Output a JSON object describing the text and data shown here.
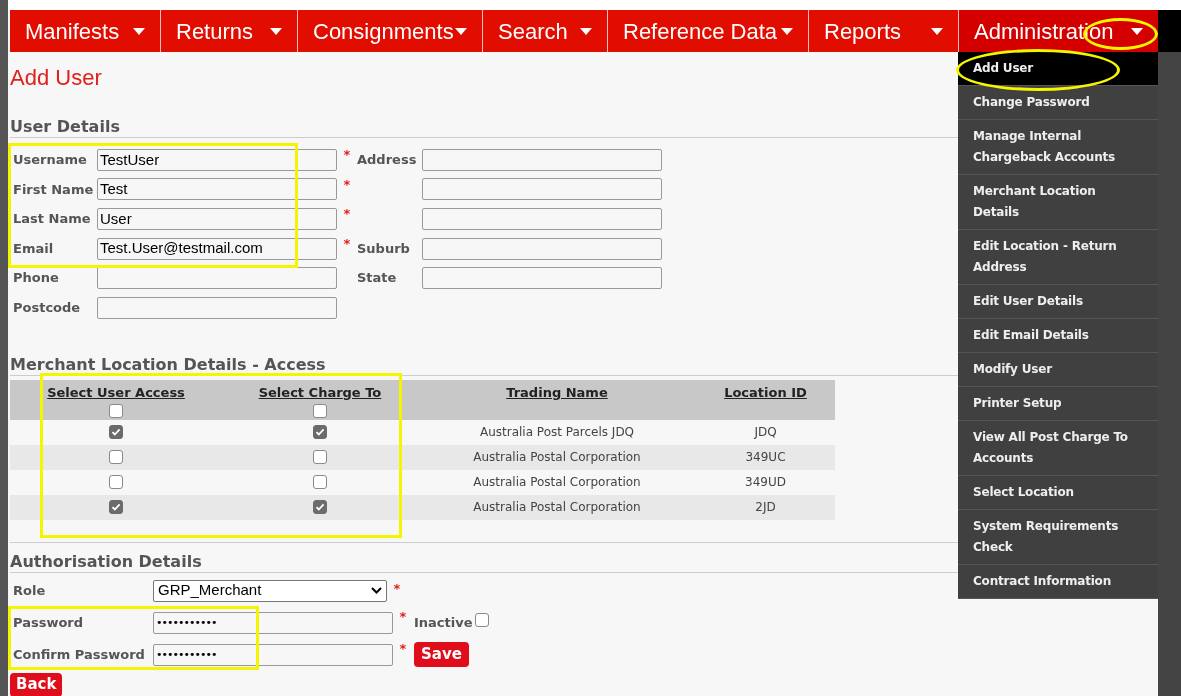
{
  "nav": [
    {
      "label": "Manifests",
      "selected": false
    },
    {
      "label": "Returns",
      "selected": false
    },
    {
      "label": "Consignments",
      "selected": false
    },
    {
      "label": "Search",
      "selected": false
    },
    {
      "label": "Reference Data",
      "selected": false
    },
    {
      "label": "Reports",
      "selected": false
    },
    {
      "label": "Administration",
      "selected": true
    }
  ],
  "menu": [
    {
      "label": "Add User",
      "selected": true
    },
    {
      "label": "Change Password",
      "selected": false
    },
    {
      "label": "Manage Internal Chargeback Accounts",
      "selected": false
    },
    {
      "label": "Merchant Location Details",
      "selected": false
    },
    {
      "label": "Edit Location - Return Address",
      "selected": false
    },
    {
      "label": "Edit User Details",
      "selected": false
    },
    {
      "label": "Edit Email Details",
      "selected": false
    },
    {
      "label": "Modify User",
      "selected": false
    },
    {
      "label": "Printer Setup",
      "selected": false
    },
    {
      "label": "View All Post Charge To Accounts",
      "selected": false
    },
    {
      "label": "Select Location",
      "selected": false
    },
    {
      "label": "System Requirements Check",
      "selected": false
    },
    {
      "label": "Contract Information",
      "selected": false
    }
  ],
  "page_title": "Add User",
  "user_details": {
    "heading": "User Details",
    "rows": [
      {
        "label": "Username",
        "value": "TestUser",
        "required_mark": "*",
        "right_label": "Address"
      },
      {
        "label": "First Name",
        "value": "Test",
        "required_mark": "*"
      },
      {
        "label": "Last Name",
        "value": "User",
        "required_mark": "*"
      },
      {
        "label": "Email",
        "value": "Test.User@testmail.com",
        "required_mark": "*",
        "right_label": "Suburb"
      },
      {
        "label": "Phone",
        "right_label": "State"
      },
      {
        "label": "Postcode"
      }
    ]
  },
  "access": {
    "heading": "Merchant Location Details - Access",
    "columns": [
      "Select User Access",
      "Select Charge To",
      "Trading Name",
      "Location ID"
    ],
    "select_all_access": false,
    "select_all_charge": false,
    "rows": [
      {
        "user_access": true,
        "charge_to": true,
        "trading_name": "Australia Post Parcels JDQ",
        "location_id": "JDQ"
      },
      {
        "user_access": false,
        "charge_to": false,
        "trading_name": "Australia Postal Corporation",
        "location_id": "349UC"
      },
      {
        "user_access": false,
        "charge_to": false,
        "trading_name": "Australia Postal Corporation",
        "location_id": "349UD"
      },
      {
        "user_access": true,
        "charge_to": true,
        "trading_name": "Australia Postal Corporation",
        "location_id": "2JD"
      }
    ]
  },
  "authorisation": {
    "heading": "Authorisation Details",
    "role": {
      "label": "Role",
      "value": "GRP_Merchant",
      "required_mark": "*"
    },
    "password": {
      "label": "Password",
      "value": "•••••••••••",
      "required_mark": "*"
    },
    "confirm_password": {
      "label": "Confirm Password",
      "value": "•••••••••••",
      "required_mark": "*"
    },
    "inactive": {
      "label": "Inactive",
      "checked": false
    },
    "save": "Save"
  },
  "back": "Back"
}
